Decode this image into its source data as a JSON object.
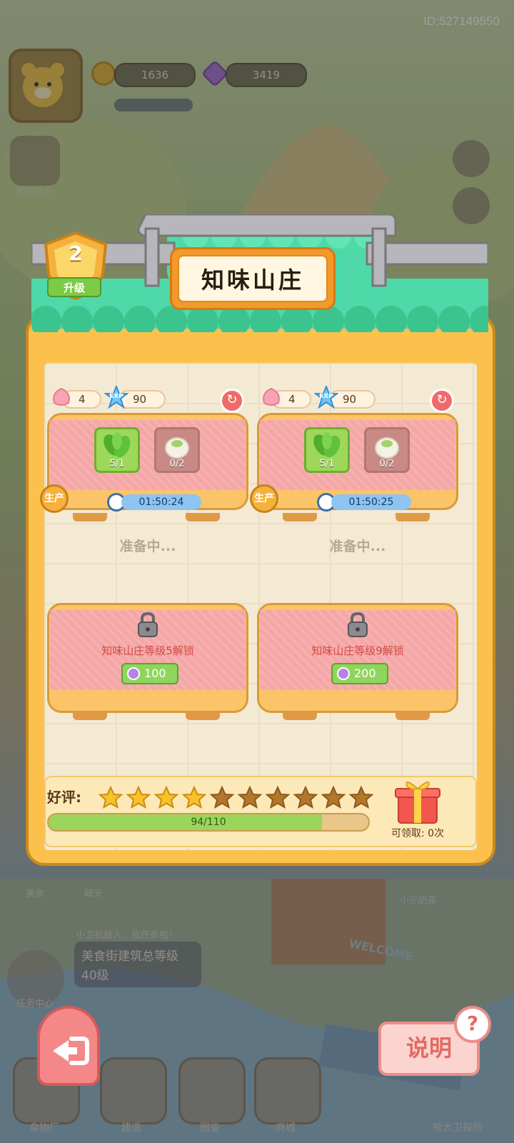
{
  "device_id": "ID:527149550",
  "hud": {
    "coins": "1636",
    "gems": "3419"
  },
  "background_labels": {
    "side_1": "首充礼包",
    "bottom_left_1": "美食",
    "bottom_left_2": "聊天",
    "robot_bubble": "小卫机器人：我任务啦！",
    "task_text_1": "美食街建筑总等级",
    "task_text_2": "40级",
    "task_center": "任务中心",
    "shop_name": "小元奶茶",
    "welcome": "WELCOME",
    "food_factory": "食物厂",
    "build": "建造",
    "atlas": "图鉴",
    "mall": "商城",
    "explore": "熊大卫探险"
  },
  "panel": {
    "title": "知味山庄",
    "level": "2",
    "upgrade_label": "升级"
  },
  "slots": [
    {
      "petals": "4",
      "exp_icon_label": "EXP",
      "exp": "90",
      "res1": "5/1",
      "res2": "0/2",
      "timer": "01:50:24",
      "prod_label": "生产",
      "status": "准备中..."
    },
    {
      "petals": "4",
      "exp_icon_label": "EXP",
      "exp": "90",
      "res1": "5/1",
      "res2": "0/2",
      "timer": "01:50:25",
      "prod_label": "生产",
      "status": "准备中..."
    }
  ],
  "locked_slots": [
    {
      "text": "知味山庄等级5解锁",
      "cost": "100"
    },
    {
      "text": "知味山庄等级9解锁",
      "cost": "200"
    }
  ],
  "rating": {
    "label": "好评:",
    "stars_filled": 4,
    "stars_total": 10,
    "progress_text": "94/110",
    "progress_value": 94,
    "progress_max": 110,
    "claim_text": "可领取: 0次"
  },
  "buttons": {
    "help_label": "说明",
    "help_icon": "?"
  },
  "colors": {
    "panel_orange": "#fbc14c",
    "roof_green": "#4fd9a9",
    "star_gold": "#f7c22a",
    "star_dark": "#b3762a",
    "progress_green": "#9bd55b"
  }
}
